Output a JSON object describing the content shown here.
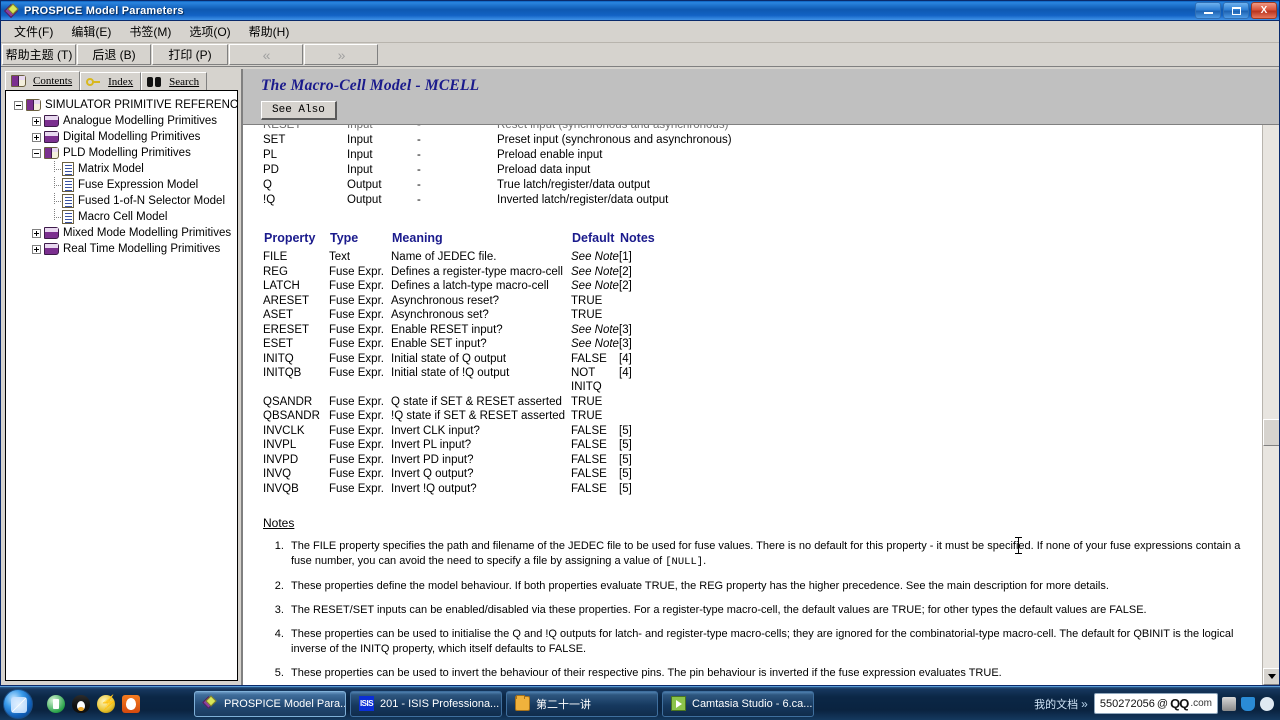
{
  "window": {
    "title": "PROSPICE Model Parameters",
    "icon": "prospice-diamond-icon",
    "minimize_label": "Minimize",
    "maximize_label": "Maximize",
    "close_label": "X"
  },
  "menu": {
    "items": [
      {
        "label": "文件(F)",
        "name": "menu-file"
      },
      {
        "label": "编辑(E)",
        "name": "menu-edit"
      },
      {
        "label": "书签(M)",
        "name": "menu-bookmark"
      },
      {
        "label": "选项(O)",
        "name": "menu-options"
      },
      {
        "label": "帮助(H)",
        "name": "menu-help"
      }
    ]
  },
  "toolbar": {
    "buttons": [
      {
        "label": "帮助主题 (T)",
        "name": "help-topics-button",
        "disabled": false
      },
      {
        "label": "后退 (B)",
        "name": "back-button",
        "disabled": false
      },
      {
        "label": "打印 (P)",
        "name": "print-button",
        "disabled": false
      },
      {
        "label": "«",
        "name": "previous-topic-button",
        "disabled": true
      },
      {
        "label": "»",
        "name": "next-topic-button",
        "disabled": true
      }
    ]
  },
  "nav": {
    "tabs": [
      {
        "label": "Contents",
        "accesskey": "C",
        "icon": "open-book-icon",
        "active": true
      },
      {
        "label": "Index",
        "accesskey": "I",
        "icon": "key-icon",
        "active": false
      },
      {
        "label": "Search",
        "accesskey": "S",
        "icon": "binoculars-icon",
        "active": false
      }
    ],
    "tree": [
      {
        "label": "SIMULATOR PRIMITIVE REFERENCE",
        "level": 1,
        "expander": "minus",
        "icon": "open-book-icon"
      },
      {
        "label": "Analogue Modelling Primitives",
        "level": 2,
        "expander": "plus",
        "icon": "closed-book-icon"
      },
      {
        "label": "Digital Modelling Primitives",
        "level": 2,
        "expander": "plus",
        "icon": "closed-book-icon"
      },
      {
        "label": "PLD Modelling Primitives",
        "level": 2,
        "expander": "minus",
        "icon": "open-book-icon"
      },
      {
        "label": "Matrix Model",
        "level": 3,
        "expander": "none",
        "icon": "page-icon"
      },
      {
        "label": "Fuse Expression Model",
        "level": 3,
        "expander": "none",
        "icon": "page-icon"
      },
      {
        "label": "Fused 1-of-N Selector Model",
        "level": 3,
        "expander": "none",
        "icon": "page-icon"
      },
      {
        "label": "Macro Cell Model",
        "level": 3,
        "expander": "none",
        "icon": "page-icon"
      },
      {
        "label": "Mixed Mode Modelling Primitives",
        "level": 2,
        "expander": "plus",
        "icon": "closed-book-icon"
      },
      {
        "label": "Real Time Modelling Primitives",
        "level": 2,
        "expander": "plus",
        "icon": "closed-book-icon"
      }
    ]
  },
  "topic": {
    "title": "The Macro-Cell Model - MCELL",
    "see_also_label": "See Also",
    "pin_table": {
      "rows": [
        {
          "name": "RESET",
          "type": "Input",
          "dash": "-",
          "meaning": "Reset input (synchronous and asynchronous)",
          "clipped": true
        },
        {
          "name": "SET",
          "type": "Input",
          "dash": "-",
          "meaning": "Preset input (synchronous and asynchronous)"
        },
        {
          "name": "PL",
          "type": "Input",
          "dash": "-",
          "meaning": "Preload enable input"
        },
        {
          "name": "PD",
          "type": "Input",
          "dash": "-",
          "meaning": "Preload data input"
        },
        {
          "name": "Q",
          "type": "Output",
          "dash": "-",
          "meaning": "True latch/register/data output"
        },
        {
          "name": "!Q",
          "type": "Output",
          "dash": "-",
          "meaning": "Inverted latch/register/data output"
        }
      ]
    },
    "prop_table": {
      "headers": [
        "Property",
        "Type",
        "Meaning",
        "Default",
        "Notes"
      ],
      "rows": [
        {
          "property": "FILE",
          "type": "Text",
          "meaning": "Name of JEDEC file.",
          "default": "See Note",
          "default_italic": true,
          "notes": "[1]"
        },
        {
          "property": "REG",
          "type": "Fuse Expr.",
          "meaning": "Defines a register-type macro-cell",
          "default": "See Note",
          "default_italic": true,
          "notes": "[2]"
        },
        {
          "property": "LATCH",
          "type": "Fuse Expr.",
          "meaning": "Defines a latch-type macro-cell",
          "default": "See Note",
          "default_italic": true,
          "notes": "[2]"
        },
        {
          "property": "ARESET",
          "type": "Fuse Expr.",
          "meaning": "Asynchronous reset?",
          "default": "TRUE",
          "default_italic": false,
          "notes": ""
        },
        {
          "property": "ASET",
          "type": "Fuse Expr.",
          "meaning": "Asynchronous set?",
          "default": "TRUE",
          "default_italic": false,
          "notes": ""
        },
        {
          "property": "ERESET",
          "type": "Fuse Expr.",
          "meaning": "Enable RESET input?",
          "default": "See Note",
          "default_italic": true,
          "notes": "[3]"
        },
        {
          "property": "ESET",
          "type": "Fuse Expr.",
          "meaning": "Enable SET input?",
          "default": "See Note",
          "default_italic": true,
          "notes": "[3]"
        },
        {
          "property": "INITQ",
          "type": "Fuse Expr.",
          "meaning": "Initial state of Q output",
          "default": "FALSE",
          "default_italic": false,
          "notes": "[4]"
        },
        {
          "property": "INITQB",
          "type": "Fuse Expr.",
          "meaning": "Initial state of !Q output",
          "default": "NOT INITQ",
          "default_italic": false,
          "notes": "[4]"
        },
        {
          "property": "QSANDR",
          "type": "Fuse Expr.",
          "meaning": "Q state if SET & RESET asserted",
          "default": "TRUE",
          "default_italic": false,
          "notes": ""
        },
        {
          "property": "QBSANDR",
          "type": "Fuse Expr.",
          "meaning": "!Q state if SET & RESET asserted",
          "default": "TRUE",
          "default_italic": false,
          "notes": ""
        },
        {
          "property": "INVCLK",
          "type": "Fuse Expr.",
          "meaning": "Invert CLK input?",
          "default": "FALSE",
          "default_italic": false,
          "notes": "[5]"
        },
        {
          "property": "INVPL",
          "type": "Fuse Expr.",
          "meaning": "Invert PL input?",
          "default": "FALSE",
          "default_italic": false,
          "notes": "[5]"
        },
        {
          "property": "INVPD",
          "type": "Fuse Expr.",
          "meaning": "Invert PD input?",
          "default": "FALSE",
          "default_italic": false,
          "notes": "[5]"
        },
        {
          "property": "INVQ",
          "type": "Fuse Expr.",
          "meaning": "Invert Q output?",
          "default": "FALSE",
          "default_italic": false,
          "notes": "[5]"
        },
        {
          "property": "INVQB",
          "type": "Fuse Expr.",
          "meaning": "Invert !Q output?",
          "default": "FALSE",
          "default_italic": false,
          "notes": "[5]"
        }
      ]
    },
    "notes_heading": "Notes",
    "notes": [
      {
        "pre": "The FILE property specifies the path and filename of the JEDEC file to be used for fuse values. There is no default for this property - it must be specified. If none of your fuse expressions contain a fuse number, you can avoid the need to specify a file by assigning a value of ",
        "code": "[NULL]",
        "post": "."
      },
      {
        "pre": "These properties define the model behaviour. If both properties evaluate TRUE, the REG property has the higher precedence. See the main description for more details.",
        "code": "",
        "post": ""
      },
      {
        "pre": "The RESET/SET inputs can be enabled/disabled via these properties. For a register-type macro-cell, the default values are TRUE; for other types the default values are FALSE.",
        "code": "",
        "post": ""
      },
      {
        "pre": "These properties can be used to initialise the Q and !Q outputs for latch- and register-type macro-cells; they are ignored for the combinatorial-type macro-cell. The default for QBINIT is the logical inverse of the INITQ property, which itself defaults to FALSE.",
        "code": "",
        "post": ""
      },
      {
        "pre": "These properties can be used to invert the behaviour of their respective pins. The pin behaviour is inverted if the fuse expression evaluates TRUE.",
        "code": "",
        "post": ""
      }
    ]
  },
  "taskbar": {
    "start_label": "Start",
    "quick_launch": [
      {
        "name": "quicklaunch-green-icon",
        "cls": "ql-green"
      },
      {
        "name": "quicklaunch-penguin-icon",
        "cls": "ql-penguin"
      },
      {
        "name": "quicklaunch-thunder-icon",
        "cls": "ql-thunder"
      },
      {
        "name": "quicklaunch-fire-icon",
        "cls": "ql-fire"
      }
    ],
    "tasks": [
      {
        "label": "PROSPICE Model Para...",
        "icon": "prospice-icon",
        "active": true
      },
      {
        "label": "201 - ISIS Professiona...",
        "icon": "isis-icon",
        "active": false
      },
      {
        "label": "第二十一讲",
        "icon": "folder-icon",
        "active": false
      },
      {
        "label": "Camtasia Studio - 6.ca...",
        "icon": "camtasia-icon",
        "active": false
      }
    ],
    "tray_label": "我的文档",
    "tray_chevron": "»",
    "qq": {
      "number": "550272056",
      "at": "@",
      "logo": "QQ",
      "dotcom": ".com"
    }
  }
}
